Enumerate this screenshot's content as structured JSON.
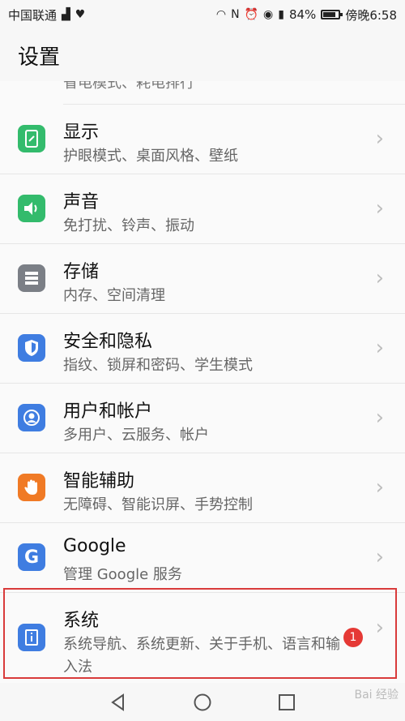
{
  "status_bar": {
    "carrier": "中国联通",
    "battery": "84%",
    "battery_level": 0.84,
    "time": "傍晚6:58"
  },
  "header": {
    "title": "设置"
  },
  "partial_item": {
    "subtitle": "省电模式、耗电排行"
  },
  "items": [
    {
      "title": "显示",
      "subtitle": "护眼模式、桌面风格、壁纸",
      "icon": "display-icon",
      "color": "#33bb6c"
    },
    {
      "title": "声音",
      "subtitle": "免打扰、铃声、振动",
      "icon": "sound-icon",
      "color": "#33bb6c"
    },
    {
      "title": "存储",
      "subtitle": "内存、空间清理",
      "icon": "storage-icon",
      "color": "#7b7f86"
    },
    {
      "title": "安全和隐私",
      "subtitle": "指纹、锁屏和密码、学生模式",
      "icon": "shield-icon",
      "color": "#3f7de1"
    },
    {
      "title": "用户和帐户",
      "subtitle": "多用户、云服务、帐户",
      "icon": "user-icon",
      "color": "#3f7de1"
    },
    {
      "title": "智能辅助",
      "subtitle": "无障碍、智能识屏、手势控制",
      "icon": "hand-icon",
      "color": "#f07a25"
    },
    {
      "title": "Google",
      "subtitle": "管理 Google 服务",
      "icon": "google-icon",
      "color": "#3f7de1"
    },
    {
      "title": "系统",
      "subtitle": "系统导航、系统更新、关于手机、语言和输入法",
      "icon": "system-icon",
      "color": "#3f7de1",
      "badge": "1"
    }
  ],
  "watermark": "Bai 经验"
}
